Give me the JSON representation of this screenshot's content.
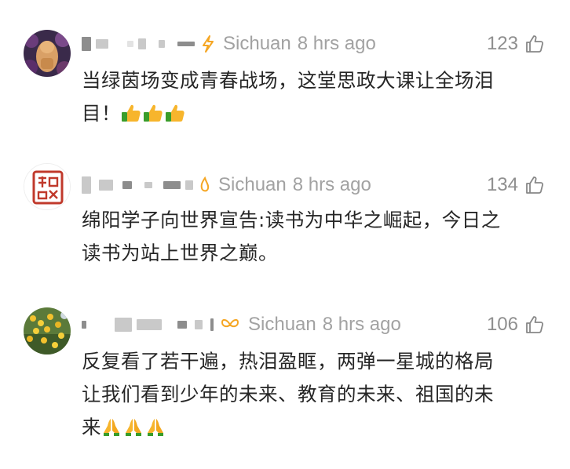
{
  "comments": [
    {
      "region": "Sichuan",
      "time": "8 hrs ago",
      "likes": "123",
      "text_lines": [
        "当绿茵场变成青春战场，这堂思政大课让全场泪",
        "目！"
      ],
      "emoji": "thumbs-up",
      "badge_icon": "lightning-badge-icon"
    },
    {
      "region": "Sichuan",
      "time": "8 hrs ago",
      "likes": "134",
      "text_lines": [
        "绵阳学子向世界宣告:读书为中华之崛起，今日之",
        "读书为站上世界之巅。"
      ],
      "badge_icon": "flame-badge-icon"
    },
    {
      "region": "Sichuan",
      "time": "8 hrs ago",
      "likes": "106",
      "text_lines": [
        "反复看了若干遍，热泪盈眶，两弹一星城的格局",
        "让我们看到少年的未来、教育的未来、祖国的未",
        "来"
      ],
      "emoji": "folded-hands",
      "badge_icon": "bow-badge-icon"
    }
  ],
  "colors": {
    "meta_text": "#a2a2a2",
    "badge_orange": "#f5a623",
    "body_text": "#262626"
  }
}
